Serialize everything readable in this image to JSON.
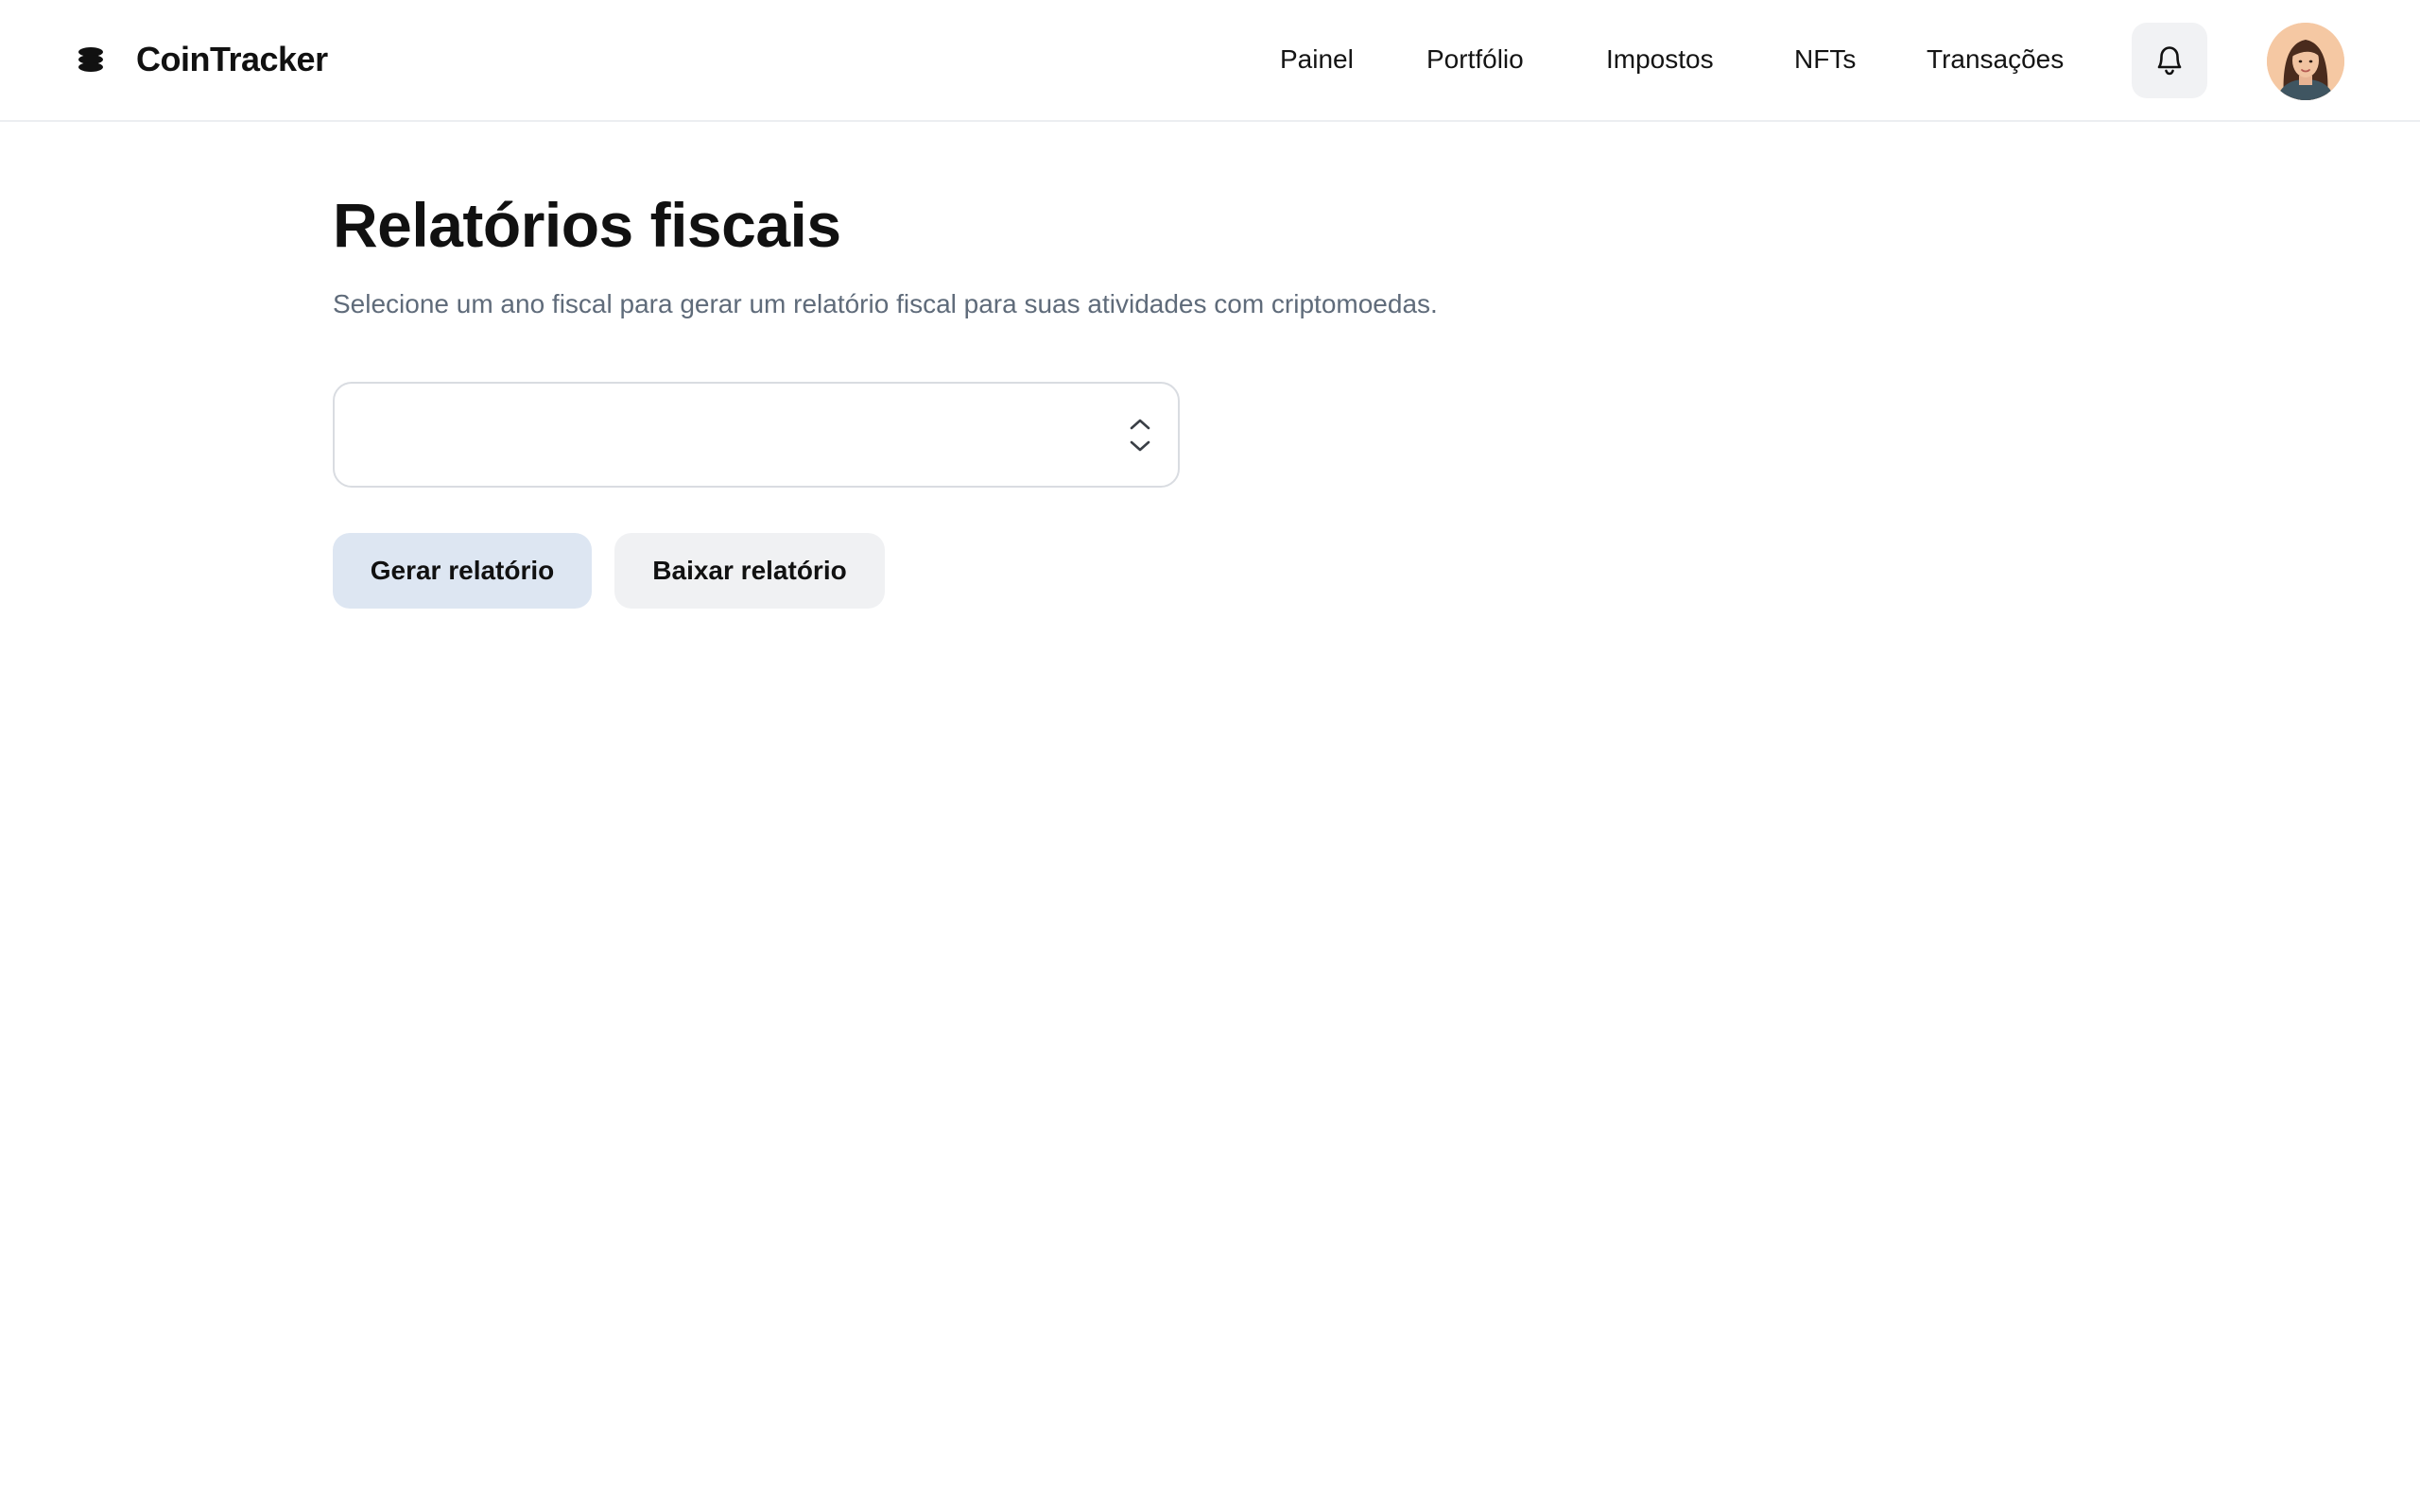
{
  "brand": {
    "name": "CoinTracker",
    "logo_icon": "stacked-coins-icon"
  },
  "nav": {
    "items": [
      {
        "label": "Painel"
      },
      {
        "label": "Portfólio"
      },
      {
        "label": "Impostos"
      },
      {
        "label": "NFTs"
      },
      {
        "label": "Transações"
      }
    ],
    "notifications_icon": "bell-icon"
  },
  "main": {
    "title": "Relatórios fiscais",
    "subtitle": "Selecione um ano fiscal para gerar um relatório fiscal para suas atividades com criptomoedas.",
    "year_select": {
      "value": "",
      "icon": "chevron-up-down-icon"
    },
    "actions": {
      "generate_label": "Gerar relatório",
      "download_label": "Baixar relatório"
    }
  },
  "colors": {
    "primary_button": "#dde6f2",
    "secondary_button": "#f0f1f3",
    "subtitle_text": "#5f6b7a",
    "border": "#d9dce1"
  }
}
